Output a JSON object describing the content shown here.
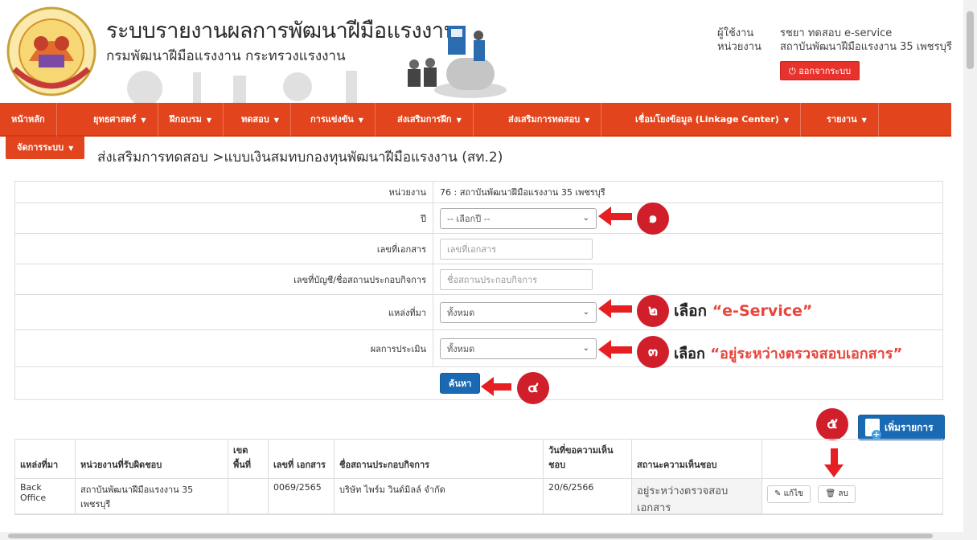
{
  "header": {
    "title": "ระบบรายงานผลการพัฒนาฝีมือแรงงาน",
    "subtitle": "กรมพัฒนาฝีมือแรงงาน กระทรวงแรงงาน",
    "user_label": "ผู้ใช้งาน",
    "unit_label": "หน่วยงาน",
    "user_value": "รชยา ทดสอบ e-service",
    "unit_value": "สถาบันพัฒนาฝีมือแรงงาน 35 เพชรบุรี",
    "logout_label": "ออกจากระบบ"
  },
  "nav": {
    "items": [
      {
        "label": "หน้าหลัก",
        "caret": false
      },
      {
        "label": "ยุทธศาสตร์",
        "caret": true
      },
      {
        "label": "ฝึกอบรม",
        "caret": true
      },
      {
        "label": "ทดสอบ",
        "caret": true
      },
      {
        "label": "การแข่งขัน",
        "caret": true
      },
      {
        "label": "ส่งเสริมการฝึก",
        "caret": true
      },
      {
        "label": "ส่งเสริมการทดสอบ",
        "caret": true
      },
      {
        "label": "เชื่อมโยงข้อมูล (Linkage Center)",
        "caret": true
      },
      {
        "label": "รายงาน",
        "caret": true
      }
    ],
    "admin_label": "จัดการระบบ"
  },
  "breadcrumb": "ส่งเสริมการทดสอบ >แบบเงินสมทบกองทุนพัฒนาฝีมือแรงงาน (สท.2)",
  "form": {
    "unit_label": "หน่วยงาน",
    "unit_value": "76 : สถาบันพัฒนาฝีมือแรงงาน 35 เพชรบุรี",
    "year_label": "ปี",
    "year_value": "-- เลือกปี --",
    "doc_label": "เลขที่เอกสาร",
    "doc_placeholder": "เลขที่เอกสาร",
    "acct_label": "เลขที่บัญชี/ชื่อสถานประกอบกิจการ",
    "acct_placeholder": "ชื่อสถานประกอบกิจการ",
    "source_label": "แหล่งที่มา",
    "source_value": "ทั้งหมด",
    "eval_label": "ผลการประเมิน",
    "eval_value": "ทั้งหมด",
    "search_label": "ค้นหา"
  },
  "annotations": {
    "b1": "๑",
    "b2": "๒",
    "b3": "๓",
    "b4": "๔",
    "b5": "๕",
    "t2_prefix": "เลือก",
    "t2_value": "“e-Service”",
    "t3_prefix": "เลือก",
    "t3_value": "“อยู่ระหว่างตรวจสอบเอกสาร”"
  },
  "add_button": "เพิ่มรายการ",
  "table": {
    "headers": [
      "แหล่งที่มา",
      "หน่วยงานที่รับผิดชอบ",
      "เขต พื้นที่",
      "เลขที่ เอกสาร",
      "ชื่อสถานประกอบกิจการ",
      "วันที่ขอความเห็น ชอบ",
      "สถานะความเห็นชอบ",
      ""
    ],
    "rows": [
      {
        "source": "Back Office",
        "unit": "สถาบันพัฒนาฝีมือแรงงาน 35 เพชรบุรี",
        "zone": "",
        "doc": "0069/2565",
        "company": "บริษัท ไพร์ม วินด์มิลล์ จำกัด",
        "date": "20/6/2566",
        "status": "อยู่ระหว่างตรวจสอบเอกสาร",
        "edit": "แก้ไข",
        "delete": "ลบ"
      }
    ]
  },
  "colors": {
    "nav_bg": "#e2451d",
    "accent_red": "#e51f22",
    "primary_blue": "#1a6ab3"
  }
}
